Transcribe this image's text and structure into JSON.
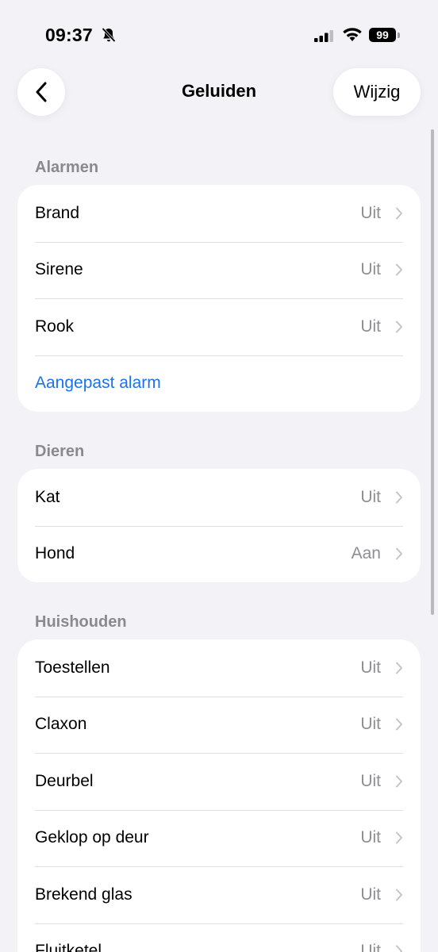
{
  "status_bar": {
    "time": "09:37",
    "battery": "99"
  },
  "nav": {
    "title": "Geluiden",
    "edit_label": "Wijzig"
  },
  "sections": [
    {
      "title": "Alarmen",
      "rows": [
        {
          "label": "Brand",
          "value": "Uit"
        },
        {
          "label": "Sirene",
          "value": "Uit"
        },
        {
          "label": "Rook",
          "value": "Uit"
        }
      ],
      "link": "Aangepast alarm"
    },
    {
      "title": "Dieren",
      "rows": [
        {
          "label": "Kat",
          "value": "Uit"
        },
        {
          "label": "Hond",
          "value": "Aan"
        }
      ]
    },
    {
      "title": "Huishouden",
      "rows": [
        {
          "label": "Toestellen",
          "value": "Uit"
        },
        {
          "label": "Claxon",
          "value": "Uit"
        },
        {
          "label": "Deurbel",
          "value": "Uit"
        },
        {
          "label": "Geklop op deur",
          "value": "Uit"
        },
        {
          "label": "Brekend glas",
          "value": "Uit"
        },
        {
          "label": "Fluitketel",
          "value": "Uit"
        }
      ]
    }
  ]
}
